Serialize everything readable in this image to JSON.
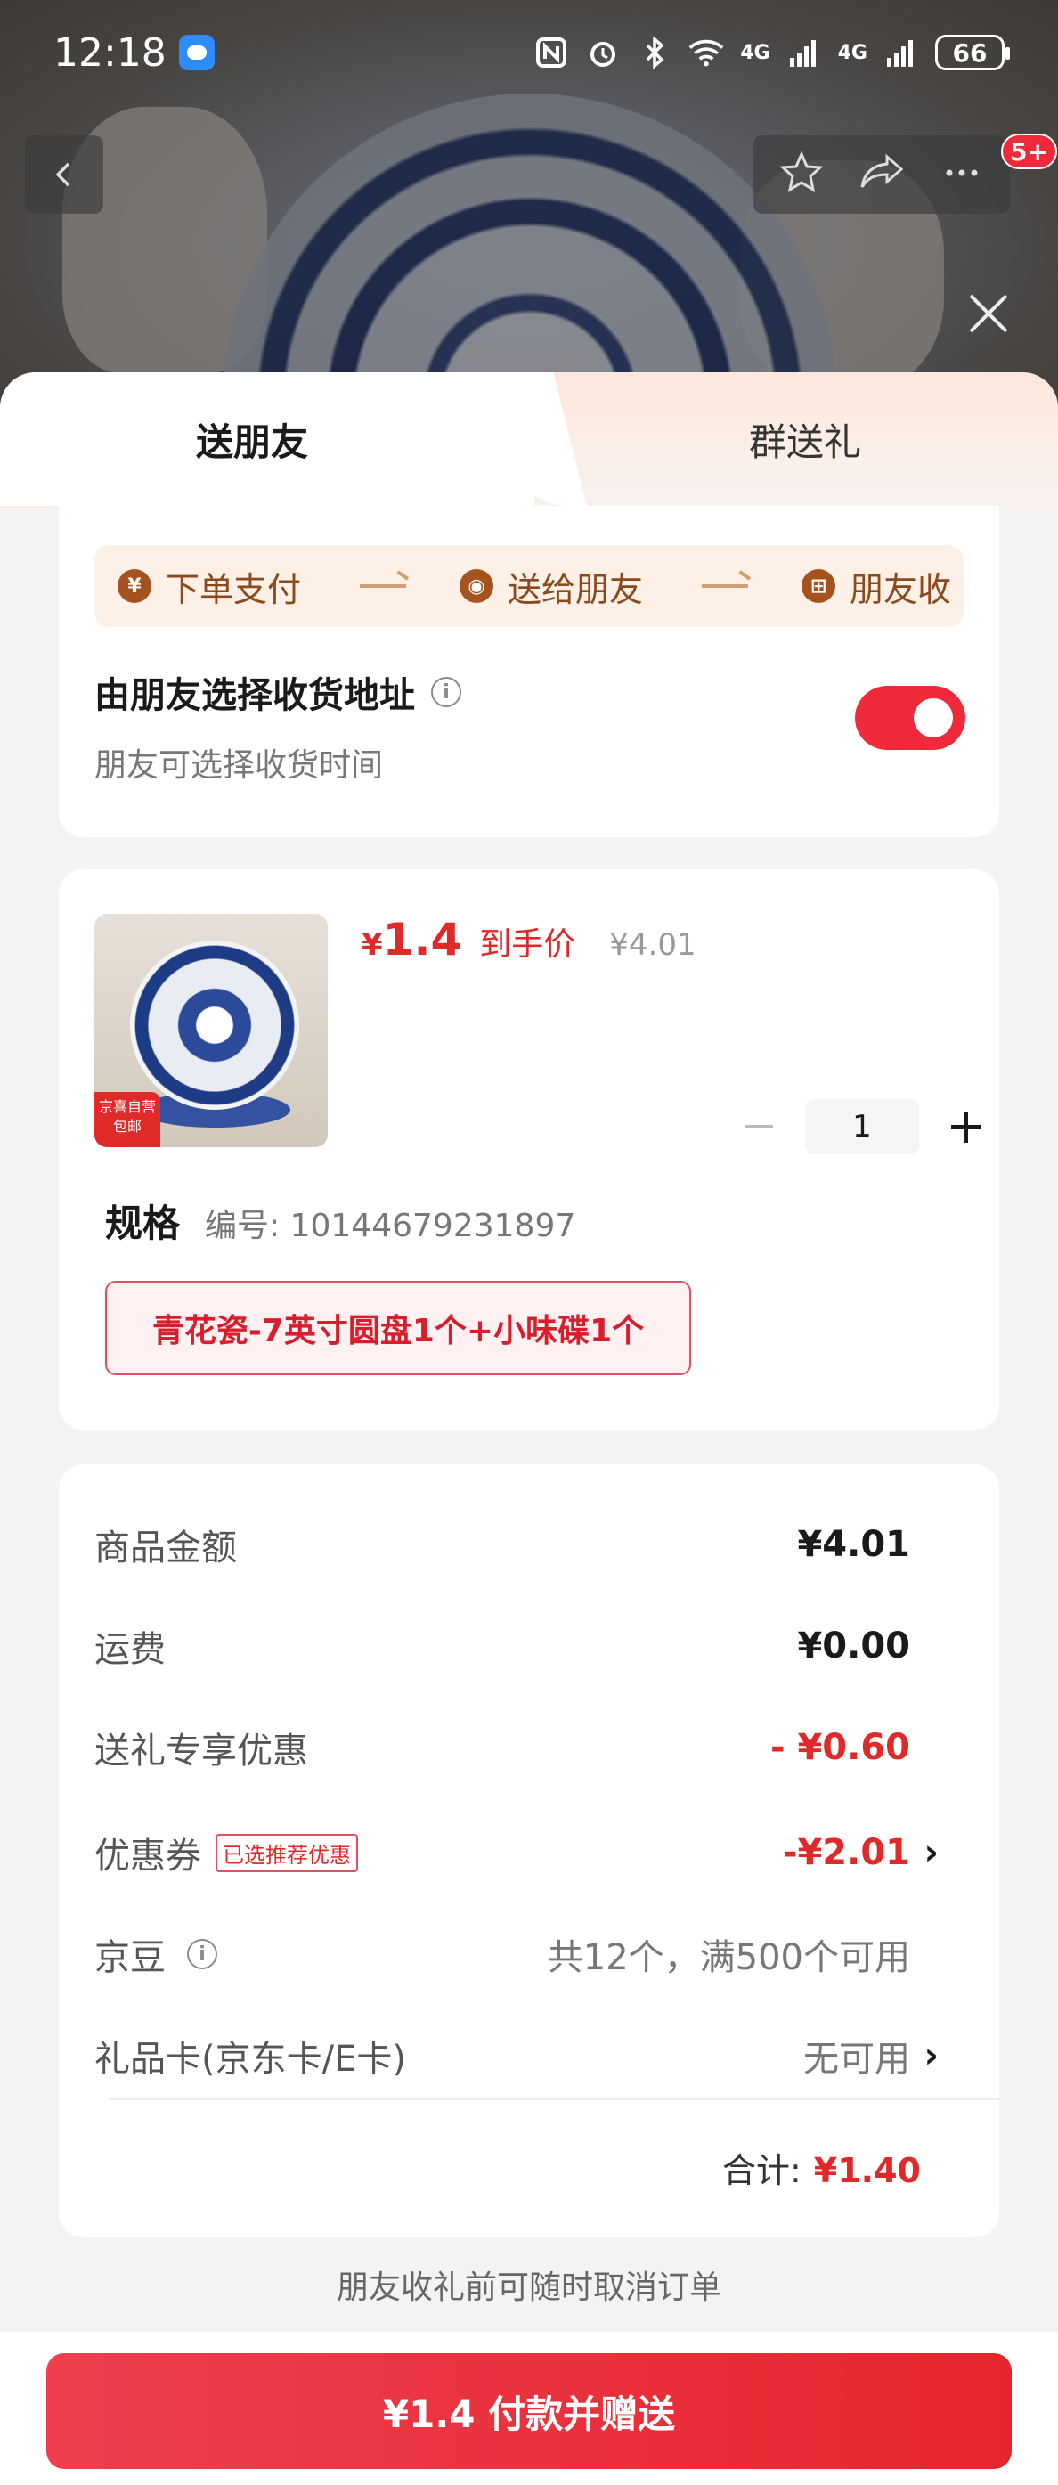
{
  "status_bar": {
    "time": "12:18",
    "battery": "66",
    "net1": "4G",
    "net2": "4G"
  },
  "nav": {
    "badge": "5+"
  },
  "tabs": [
    {
      "label": "送朋友"
    },
    {
      "label": "群送礼"
    }
  ],
  "flow": {
    "steps": [
      {
        "icon": "¥",
        "label": "下单支付"
      },
      {
        "icon": "◉",
        "label": "送给朋友"
      },
      {
        "icon": "⊞",
        "label": "朋友收"
      }
    ]
  },
  "address": {
    "title": "由朋友选择收货地址",
    "subtitle": "朋友可选择收货时间",
    "toggle_on": true
  },
  "product": {
    "thumb_tag": "京喜自营 包邮",
    "price_symbol": "¥",
    "price": "1.4",
    "price_label": "到手价",
    "original_price": "¥4.01",
    "quantity": "1",
    "spec_title": "规格",
    "spec_number": "编号: 10144679231897",
    "spec_option": "青花瓷-7英寸圆盘1个+小味碟1个"
  },
  "summary": {
    "rows": [
      {
        "label": "商品金额",
        "value": "¥4.01"
      },
      {
        "label": "运费",
        "value": "¥0.00"
      },
      {
        "label": "送礼专享优惠",
        "value": "- ¥0.60"
      },
      {
        "label": "优惠券",
        "tag": "已选推荐优惠",
        "value": "-¥2.01"
      },
      {
        "label": "京豆",
        "value": "共12个，满500个可用"
      },
      {
        "label": "礼品卡(京东卡/E卡)",
        "value": "无可用"
      }
    ],
    "total_label": "合计:",
    "total_value": "¥1.40"
  },
  "footer": {
    "note": "朋友收礼前可随时取消订单",
    "pay_button": "¥1.4 付款并赠送"
  },
  "colors": {
    "accent": "#e02a2a",
    "toggle": "#ef2a3a",
    "flow_bg": "#fdf0e6"
  }
}
